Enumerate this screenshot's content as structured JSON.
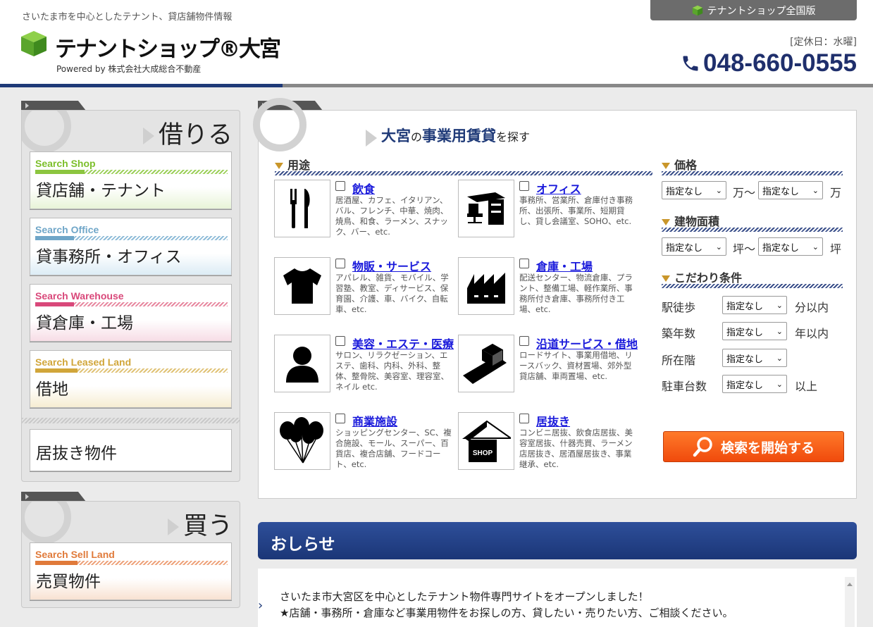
{
  "header": {
    "tagline": "さいたま市を中心としたテナント、貸店舗物件情報",
    "logo_title": "テナントショップ®大宮",
    "logo_sub": "Powered by  株式会社大成総合不動産",
    "national_link": "テナントショップ全国版",
    "holiday": "[定休日：水曜]",
    "phone": "048-660-0555"
  },
  "rent_box": {
    "heading": "借りる",
    "cards": [
      {
        "en": "Search Shop",
        "ja": "貸店舗・テナント"
      },
      {
        "en": "Search Office",
        "ja": "貸事務所・オフィス"
      },
      {
        "en": "Search Warehouse",
        "ja": "貸倉庫・工場"
      },
      {
        "en": "Search Leased Land",
        "ja": "借地"
      }
    ],
    "extra": "居抜き物件"
  },
  "buy_box": {
    "heading": "買う",
    "card": {
      "en": "Search Sell Land",
      "ja": "売買物件"
    }
  },
  "search": {
    "title_1": "大宮",
    "title_2": "の",
    "title_3": "事業用賃貸",
    "title_4": "を探す",
    "usage_label": "用途",
    "categories": [
      {
        "name": "飲食",
        "desc": "居酒屋、カフェ、イタリアン、バル、フレンチ、中華、焼肉、焼鳥、和食、ラーメン、スナック、バー、etc."
      },
      {
        "name": "オフィス",
        "desc": "事務所、営業所、倉庫付き事務所、出張所、事業所、短期貸し、貸し会議室、SOHO、etc."
      },
      {
        "name": "物販・サービス",
        "desc": "アパレル、雑貨、モバイル、学習塾、教室、ディサービス、保育園、介護、車、バイク、自転車、etc."
      },
      {
        "name": "倉庫・工場",
        "desc": "配送センター、物流倉庫、プラント、整備工場、軽作業所、事務所付き倉庫、事務所付き工場、etc."
      },
      {
        "name": "美容・エステ・医療",
        "desc": "サロン、リラクゼーション、エステ、歯科、内科、外科、整体、整骨院、美容室、理容室、ネイル etc."
      },
      {
        "name": "沿道サービス・借地",
        "desc": "ロードサイト、事業用借地、リースバック、資材置場、郊外型貸店舗、車両置場、etc."
      },
      {
        "name": "商業施設",
        "desc": "ショッピングセンター、SC、複合施設、モール、スーパー、百貨店、複合店舗、フードコート、etc."
      },
      {
        "name": "居抜き",
        "desc": "コンビニ居抜、飲食店居抜、美容室居抜、什器売買、ラーメン店居抜き、居酒屋居抜き、事業継承、etc."
      }
    ],
    "price_label": "価格",
    "area_label": "建物面積",
    "cond_label": "こだわり条件",
    "select_default": "指定なし",
    "unit_man_from": "万～",
    "unit_man": "万",
    "unit_tsubo_from": "坪～",
    "unit_tsubo": "坪",
    "conditions": [
      {
        "label": "駅徒歩",
        "unit": "分以内"
      },
      {
        "label": "築年数",
        "unit": "年以内"
      },
      {
        "label": "所在階",
        "unit": ""
      },
      {
        "label": "駐車台数",
        "unit": "以上"
      }
    ],
    "button": "検索を開始する"
  },
  "news": {
    "heading": "おしらせ",
    "line1": "さいたま市大宮区を中心としたテナント物件専門サイトをオープンしました！",
    "line2": "★店舗・事務所・倉庫など事業用物件をお探しの方、貸したい・売りたい方、ご相談ください。"
  },
  "colors": {
    "brand_blue": "#1f3a78",
    "accent_orange": "#f04a0c",
    "link_blue": "#1a1adb"
  }
}
